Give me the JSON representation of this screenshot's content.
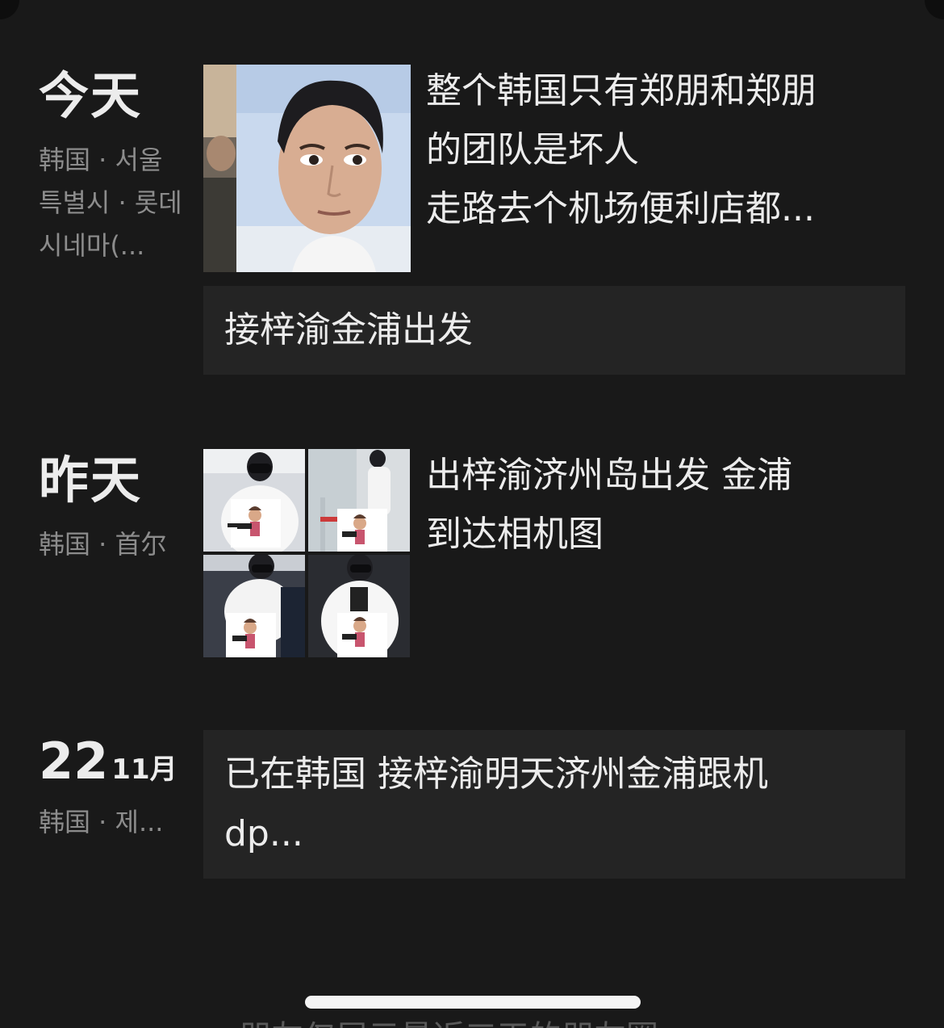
{
  "colors": {
    "background": "#191919",
    "card": "#242424",
    "primary_text": "#ececec",
    "secondary_text": "#8c8c8c"
  },
  "entries": [
    {
      "date": "今天",
      "location": "韩国 · 서울특별시 · 롯데시네마(...",
      "text_lines": [
        "整个韩国只有郑朋和郑朋",
        "的团队是坏人",
        "走路去个机场便利店都..."
      ],
      "image_icon": "photo-thumbnail"
    },
    {
      "card_text": "接梓渝金浦出发"
    },
    {
      "date": "昨天",
      "location": "韩国 · 首尔",
      "text_lines": [
        "出梓渝济州岛出发 金浦",
        "到达相机图"
      ],
      "image_icon": "photo-grid"
    },
    {
      "day": "22",
      "month": "11月",
      "location": "韩国 · 제...",
      "card_lines": [
        "已在韩国 接梓渝明天济州金浦跟机",
        "dp..."
      ]
    }
  ],
  "footer": {
    "text": "朋友仅展示最近三天的朋友圈"
  }
}
